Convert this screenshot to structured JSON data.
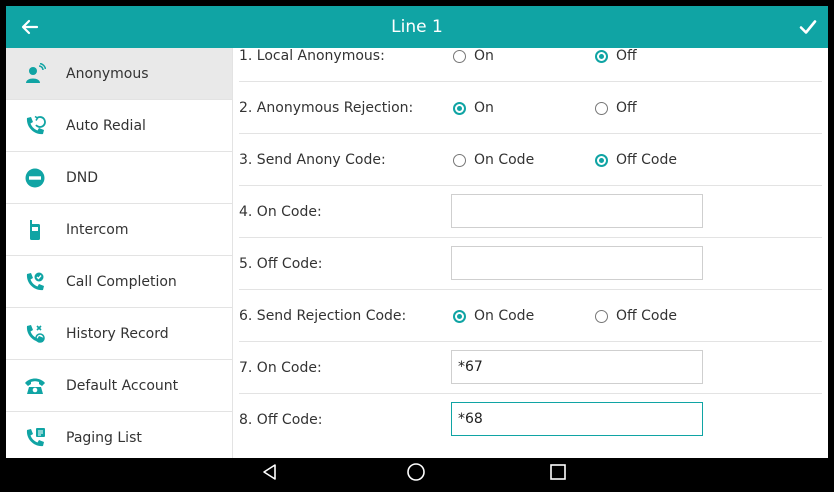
{
  "colors": {
    "accent": "#10a4a4",
    "header_text": "#ffffff",
    "active_item_bg": "#e9e9e9"
  },
  "header": {
    "title": "Line 1",
    "back_icon": "arrow-left-icon",
    "confirm_icon": "checkmark-icon"
  },
  "sidebar": {
    "items": [
      {
        "label": "Anonymous",
        "icon": "anonymous-icon",
        "active": true
      },
      {
        "label": "Auto Redial",
        "icon": "auto-redial-icon",
        "active": false
      },
      {
        "label": "DND",
        "icon": "dnd-icon",
        "active": false
      },
      {
        "label": "Intercom",
        "icon": "intercom-icon",
        "active": false
      },
      {
        "label": "Call Completion",
        "icon": "call-completion-icon",
        "active": false
      },
      {
        "label": "History Record",
        "icon": "history-record-icon",
        "active": false
      },
      {
        "label": "Default Account",
        "icon": "default-account-icon",
        "active": false
      },
      {
        "label": "Paging List",
        "icon": "paging-list-icon",
        "active": false
      }
    ]
  },
  "settings": {
    "local_anonymous": {
      "label": "1. Local Anonymous:",
      "options": [
        "On",
        "Off"
      ],
      "selected": "Off"
    },
    "anonymous_rejection": {
      "label": "2. Anonymous Rejection:",
      "options": [
        "On",
        "Off"
      ],
      "selected": "On"
    },
    "send_anony_code": {
      "label": "3. Send Anony Code:",
      "options": [
        "On Code",
        "Off Code"
      ],
      "selected": "Off Code"
    },
    "on_code_1": {
      "label": "4. On Code:",
      "value": ""
    },
    "off_code_1": {
      "label": "5. Off Code:",
      "value": ""
    },
    "send_rejection_code": {
      "label": "6. Send Rejection Code:",
      "options": [
        "On Code",
        "Off Code"
      ],
      "selected": "On Code"
    },
    "on_code_2": {
      "label": "7. On Code:",
      "value": "*67"
    },
    "off_code_2": {
      "label": "8. Off Code:",
      "value": "*68"
    }
  },
  "navbar": {
    "back_icon": "nav-back-triangle-icon",
    "home_icon": "nav-home-circle-icon",
    "recents_icon": "nav-recents-square-icon"
  }
}
